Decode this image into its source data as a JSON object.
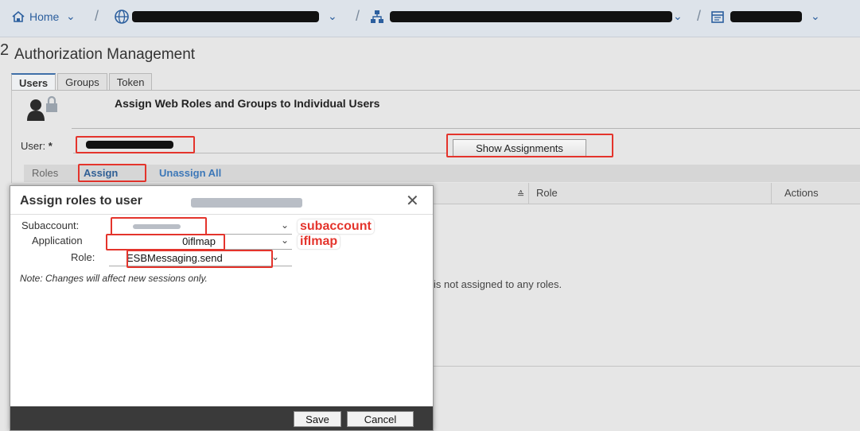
{
  "nav": {
    "home_label": "Home",
    "separator": "/"
  },
  "edge_char": "2",
  "page_title": "Authorization Management",
  "tabs": [
    {
      "label": "Users",
      "active": true
    },
    {
      "label": "Groups",
      "active": false
    },
    {
      "label": "Token",
      "active": false
    }
  ],
  "section_title": "Assign Web Roles and Groups to Individual Users",
  "user_label": "User:",
  "required_mark": "*",
  "show_assignments_label": "Show Assignments",
  "subtabs": {
    "roles": "Roles",
    "assign": "Assign",
    "unassign_all": "Unassign All"
  },
  "grid": {
    "columns": [
      "Role",
      "Actions"
    ],
    "sort_glyph": "≙",
    "empty_message": "is not assigned to any roles."
  },
  "dialog": {
    "title": "Assign roles to user",
    "close_glyph": "✕",
    "subaccount_label": "Subaccount:",
    "application_label": "Application",
    "application_value": "0iflmap",
    "role_label": "Role:",
    "role_value": "ESBMessaging.send",
    "note": "Note: Changes will affect new sessions only.",
    "save_label": "Save",
    "cancel_label": "Cancel"
  },
  "annotations": {
    "subaccount": "subaccount",
    "iflmap": "iflmap"
  },
  "colors": {
    "highlight": "#e4342c",
    "link": "#3d78b8",
    "dialog_footer": "#3a3a3a"
  },
  "icons": [
    "home-icon",
    "globe-icon",
    "network-icon",
    "calendar-icon",
    "user-lock-icon",
    "close-icon",
    "chevron-down-icon"
  ]
}
